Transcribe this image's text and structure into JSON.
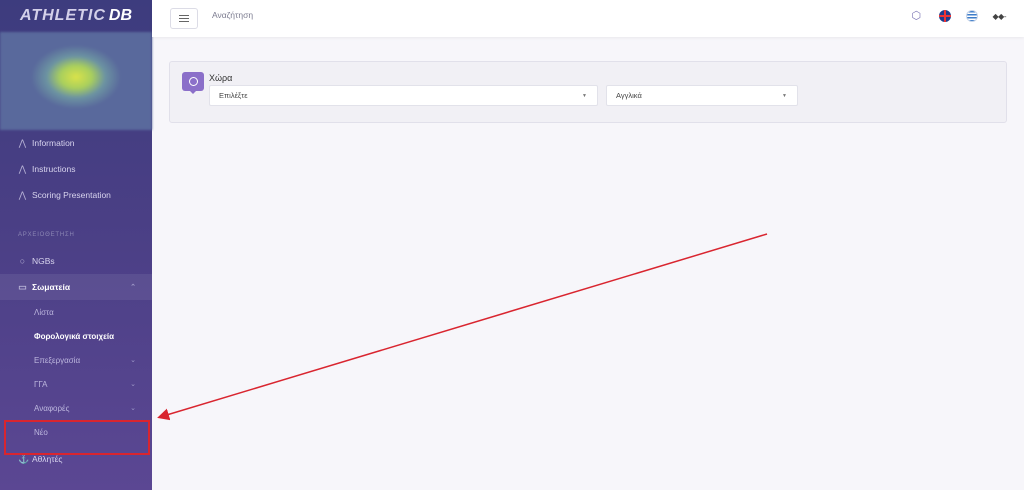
{
  "app": {
    "logo_part1": "ATHLETIC",
    "logo_part2": "DB"
  },
  "topbar": {
    "search_label": "Αναζήτηση",
    "user_menu": "◆◆-"
  },
  "sidebar": {
    "items": [
      {
        "label": "Information",
        "icon": "athletic-logo-icon"
      },
      {
        "label": "Instructions",
        "icon": "athletic-logo-icon"
      },
      {
        "label": "Scoring Presentation",
        "icon": "athletic-logo-icon"
      }
    ],
    "section_heading": "ΑΡΧΕΙΟΘΕΤΗΣΗ",
    "ngbs": "NGBs",
    "clubs": "Σωματεία",
    "sub_items": [
      {
        "label": "Λίστα"
      },
      {
        "label": "Φορολογικά στοιχεία"
      },
      {
        "label": "Επεξεργασία"
      },
      {
        "label": "ΓΓΑ"
      },
      {
        "label": "Αναφορές"
      },
      {
        "label": "Νέο"
      }
    ],
    "athletes": "Αθλητές"
  },
  "filter": {
    "label": "Χώρα",
    "country_value": "Επιλέξτε",
    "language_value": "Αγγλικά"
  },
  "colors": {
    "sidebar": "#4a3f85",
    "accent": "#8b6fc9",
    "annotation": "#d9252f"
  }
}
